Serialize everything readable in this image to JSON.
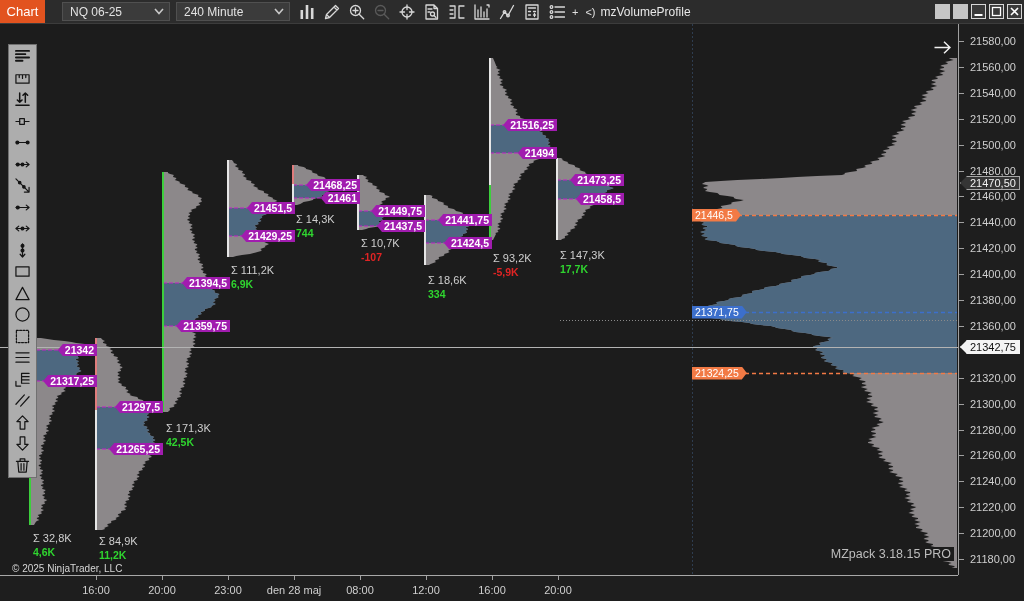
{
  "toolbar": {
    "chart_button": "Chart",
    "instrument": "NQ 06-25",
    "interval": "240 Minute",
    "tools": [
      {
        "kind": "bars",
        "disabled": false
      },
      {
        "kind": "pencil",
        "disabled": false
      },
      {
        "kind": "zoom-in",
        "disabled": false
      },
      {
        "kind": "zoom-out",
        "disabled": true
      },
      {
        "kind": "crosshair",
        "disabled": false
      },
      {
        "kind": "properties",
        "disabled": false
      },
      {
        "kind": "bracket",
        "disabled": false
      },
      {
        "kind": "boxed-bars",
        "disabled": false
      },
      {
        "kind": "line-chart",
        "disabled": false
      },
      {
        "kind": "calculator",
        "disabled": false
      },
      {
        "kind": "list",
        "disabled": false
      }
    ],
    "extras": [
      "+",
      "<)"
    ],
    "indicator": "mzVolumeProfile"
  },
  "profiles": [
    {
      "upper_label": "21342",
      "lower_label": "21317,25",
      "total": "Σ 32,8K",
      "delta": {
        "text": "4,6K",
        "color": "#2fd52f"
      }
    },
    {
      "upper_label": "21297,5",
      "lower_label": "21265,25",
      "total": "Σ 84,9K",
      "delta": {
        "text": "11,2K",
        "color": "#2fd52f"
      }
    },
    {
      "upper_label": "21394,5",
      "lower_label": "21359,75",
      "total": "Σ 171,3K",
      "delta": {
        "text": "42,5K",
        "color": "#2fd52f"
      }
    },
    {
      "upper_label": "21451,5",
      "lower_label": "21429,25",
      "total": "Σ 111,2K",
      "delta": {
        "text": "6,9K",
        "color": "#2fd52f"
      }
    },
    {
      "upper_label": "21468,25",
      "lower_label": "21461",
      "total": "Σ 14,3K",
      "delta": {
        "text": "744",
        "color": "#2fd52f"
      }
    },
    {
      "upper_label": "21449,75",
      "lower_label": "21437,5",
      "total": "Σ 10,7K",
      "delta": {
        "text": "-107",
        "color": "#e02424"
      }
    },
    {
      "upper_label": "21441,75",
      "lower_label": "21424,5",
      "total": "Σ 18,6K",
      "delta": {
        "text": "334",
        "color": "#2fd52f"
      }
    },
    {
      "upper_label": "21516,25",
      "lower_label": "21494",
      "total": "Σ 93,2K",
      "delta": {
        "text": "-5,9K",
        "color": "#e02424"
      }
    },
    {
      "upper_label": "21473,25",
      "lower_label": "21458,5",
      "total": "Σ 147,3K",
      "delta": {
        "text": "17,7K",
        "color": "#2fd52f"
      }
    }
  ],
  "composite": {
    "levels": [
      {
        "label": "21446,5",
        "color": "#f27a45"
      },
      {
        "label": "21371,75",
        "color": "#3c6fcc"
      },
      {
        "label": "21324,25",
        "color": "#f27a45"
      }
    ]
  },
  "price_axis": {
    "ticks": [
      "21580,00",
      "21560,00",
      "21540,00",
      "21520,00",
      "21500,00",
      "21480,00",
      "21460,00",
      "21440,00",
      "21420,00",
      "21400,00",
      "21380,00",
      "21360,00",
      "21320,00",
      "21300,00",
      "21280,00",
      "21260,00",
      "21240,00",
      "21220,00",
      "21200,00",
      "21180,00"
    ],
    "markers": [
      {
        "label": "21470,50",
        "kind": "outline"
      },
      {
        "label": "21342,75",
        "kind": "filled"
      }
    ]
  },
  "time_axis": {
    "ticks": [
      "16:00",
      "20:00",
      "23:00",
      "den 28 maj",
      "08:00",
      "12:00",
      "16:00",
      "20:00"
    ]
  },
  "copyright": "© 2025 NinjaTrader, LLC",
  "version": "MZpack 3.18.15 PRO"
}
